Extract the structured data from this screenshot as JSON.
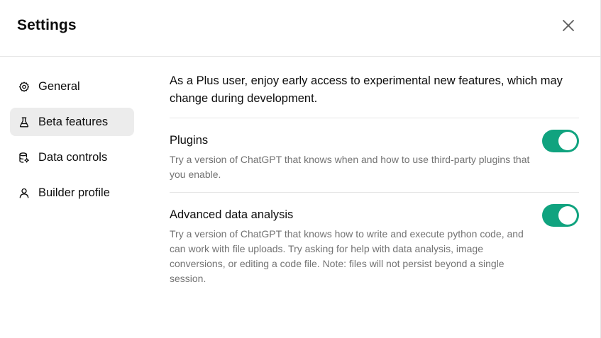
{
  "dialog": {
    "title": "Settings"
  },
  "sidebar": {
    "items": [
      {
        "label": "General",
        "icon": "gear-icon",
        "active": false
      },
      {
        "label": "Beta features",
        "icon": "flask-icon",
        "active": true
      },
      {
        "label": "Data controls",
        "icon": "database-icon",
        "active": false
      },
      {
        "label": "Builder profile",
        "icon": "user-icon",
        "active": false
      }
    ]
  },
  "beta": {
    "intro": "As a Plus user, enjoy early access to experimental new features, which may change during development.",
    "features": [
      {
        "title": "Plugins",
        "description": "Try a version of ChatGPT that knows when and how to use third-party plugins that you enable.",
        "enabled": true
      },
      {
        "title": "Advanced data analysis",
        "description": "Try a version of ChatGPT that knows how to write and execute python code, and can work with file uploads. Try asking for help with data analysis, image conversions, or editing a code file. Note: files will not persist beyond a single session.",
        "enabled": true
      }
    ]
  },
  "colors": {
    "toggle_on": "#10a37f",
    "active_nav_bg": "#ececec",
    "description_text": "#737373"
  }
}
